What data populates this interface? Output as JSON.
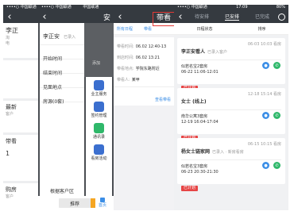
{
  "screen1": {
    "status": {
      "carrier": "••••○ 中国联通",
      "net": "中国联通"
    },
    "nav_title": "",
    "profile_name": "李正",
    "profile_line1": "淘",
    "profile_line2": "电",
    "row_a": "",
    "row_b": "",
    "section_new": "最新",
    "section_new_sub": "客户",
    "row_c": "客户",
    "section_visit": "带看",
    "visit_count": "1",
    "visit_label": "",
    "section_house": "购房",
    "house_sub": "客户"
  },
  "screen2": {
    "status": {
      "carrier": "••••○ 中国联通",
      "net": "中国联通"
    },
    "nav_title": "安",
    "name": "李正安",
    "name_sub": "已录入",
    "fields": [
      {
        "label": "开始时间",
        "value": ""
      },
      {
        "label": "结束时间",
        "value": ""
      },
      {
        "label": "见面地点",
        "value": ""
      },
      {
        "label": "房源(0套)",
        "value": ""
      }
    ],
    "dial_label": "添加",
    "bottom_label": "根据客户区",
    "buttons": {
      "edit": "推荐",
      "primary": ""
    },
    "actions": [
      {
        "label": "业主服务",
        "color": "#3b6fcf"
      },
      {
        "label": "签约管理",
        "color": "#3b6fcf"
      },
      {
        "label": "通讯录",
        "color": "#2fb86a"
      },
      {
        "label": "看房活动",
        "color": "#3b6fcf"
      }
    ],
    "tab_label": "首页"
  },
  "screen3": {
    "status": {
      "carrier": "",
      "net": ""
    },
    "nav_title": "带看",
    "filter": "所有日程",
    "filter2": "带看",
    "details": [
      {
        "label": "带看时间:",
        "value": "06.02 12:40-13"
      },
      {
        "label": "到店时间:",
        "value": "06.02 13:21"
      },
      {
        "label": "带看地点:",
        "value": "学院东路附近"
      },
      {
        "label": "带看人:",
        "value": "某甲"
      }
    ],
    "link": "查看带看"
  },
  "screen4": {
    "status": {
      "carrier": "••••○ 中国联通",
      "time": "17:09",
      "battery": "80%"
    },
    "tabs": [
      "待安排",
      "已安排",
      "已完成"
    ],
    "active_tab": 1,
    "filters": [
      "日程状态",
      "排序"
    ],
    "items": [
      {
        "name": "李正安看人",
        "sub": "已录入客户",
        "date": "06-03 10:03 看房",
        "house": "似若名宝2套房",
        "time": "06-22 11:06-12:01",
        "tag": "已计划"
      },
      {
        "name": "女士 (线上)",
        "sub": "",
        "date": "12-18 15:14 看房",
        "house": "南华公寓3套房",
        "time": "12-19 16:04-17:04",
        "tag": "已计划"
      },
      {
        "name": "杨女士链家网",
        "sub": "已录入 · 新房看房",
        "date": "06-15 10:15 看房",
        "house": "似若名宝3套房",
        "time": "06-23 20:30-21:30",
        "tag": "已计划"
      }
    ]
  }
}
